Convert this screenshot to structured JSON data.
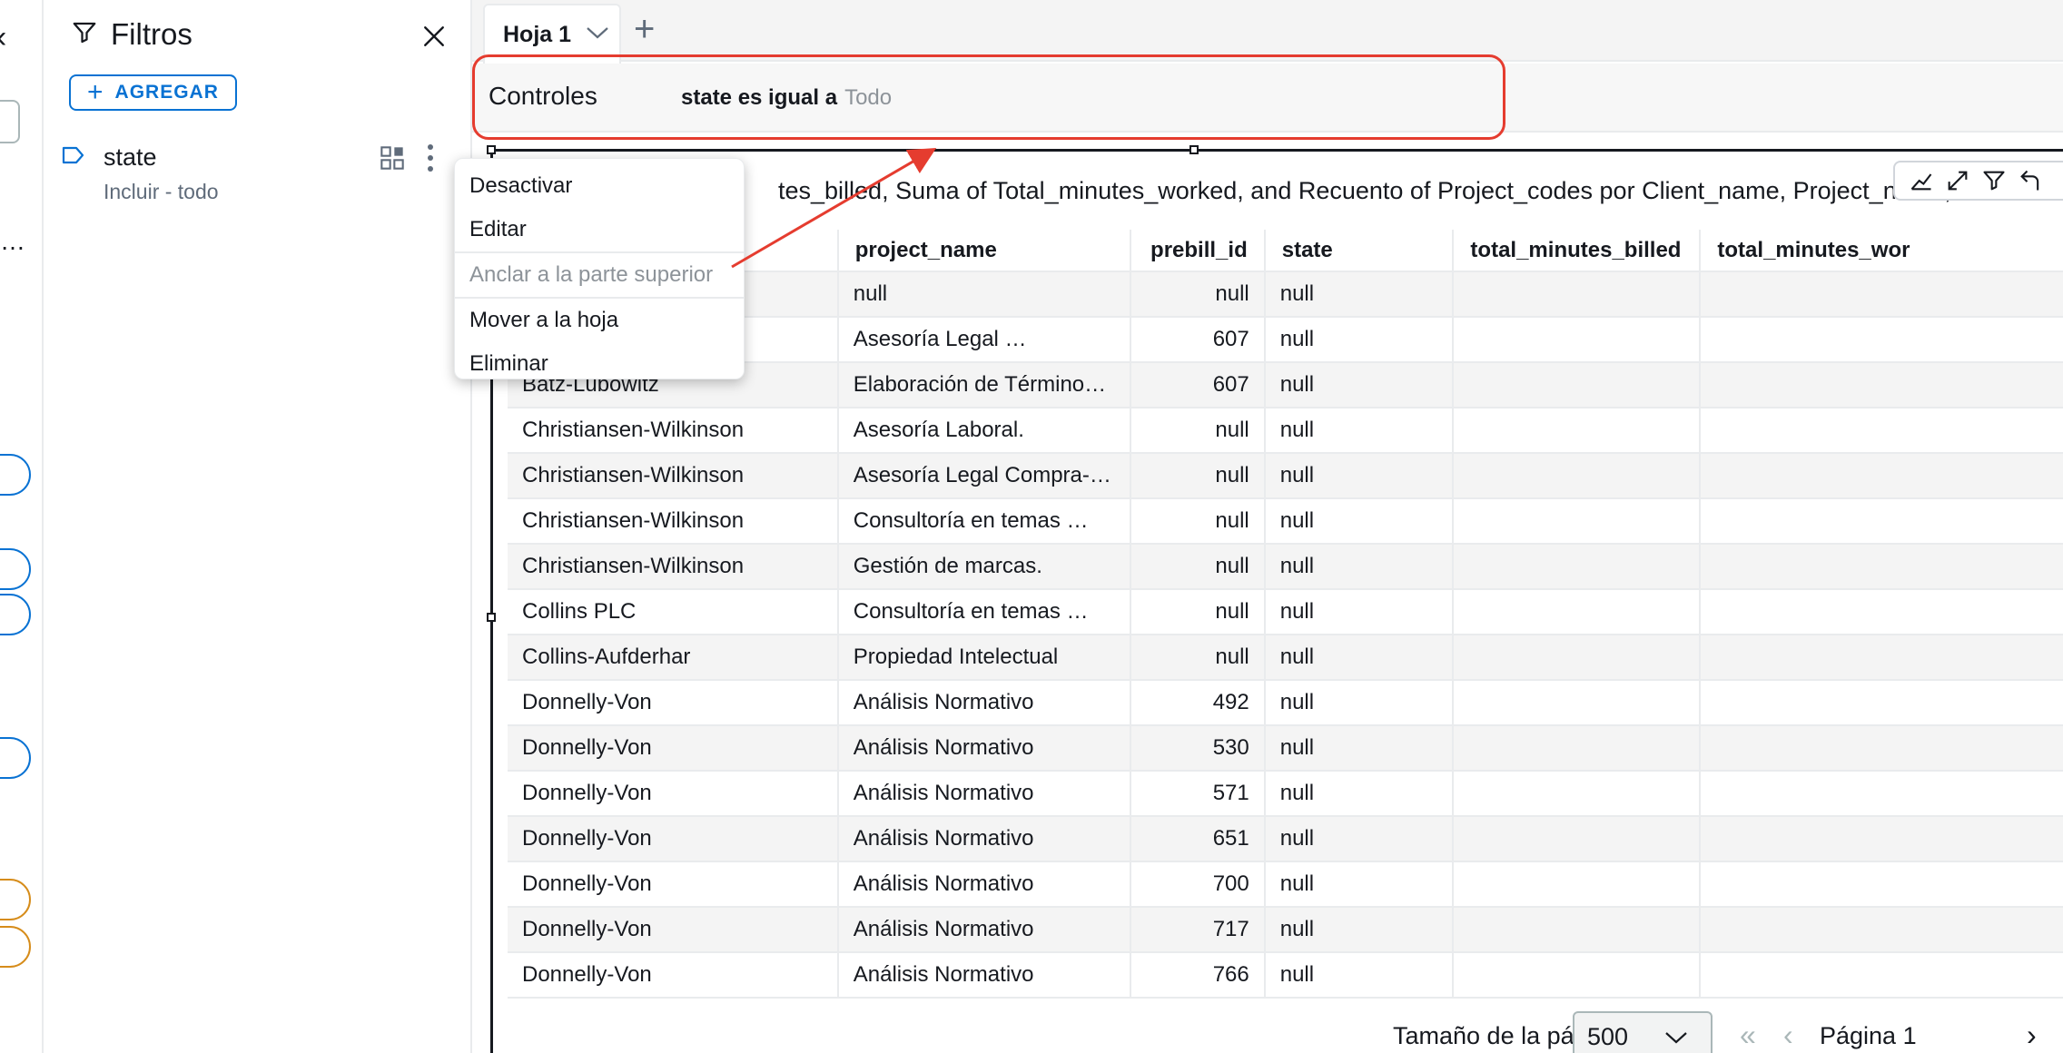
{
  "filters_panel": {
    "title": "Filtros",
    "add_button": "AGREGAR",
    "filter": {
      "name": "state",
      "subtitle": "Incluir - todo"
    }
  },
  "context_menu": {
    "items": [
      "Desactivar",
      "Editar",
      "Anclar a la parte superior",
      "Mover a la hoja",
      "Eliminar"
    ]
  },
  "sheet": {
    "tab_label": "Hoja 1"
  },
  "controls": {
    "label": "Controles",
    "condition": "state es igual a",
    "value": "Todo"
  },
  "visual": {
    "title": "tes_billed, Suma of Total_minutes_worked, and Recuento of Project_codes por Client_name, Project_name, Pr",
    "columns": [
      "project_name",
      "prebill_id",
      "state",
      "total_minutes_billed",
      "total_minutes_wor"
    ],
    "rows": [
      [
        "",
        "null",
        "null",
        "null",
        "",
        ""
      ],
      [
        "",
        "Asesoría Legal …",
        "607",
        "null",
        "",
        ""
      ],
      [
        "Batz-Lubowitz",
        "Elaboración de Término…",
        "607",
        "null",
        "",
        ""
      ],
      [
        "Christiansen-Wilkinson",
        "Asesoría Laboral.",
        "null",
        "null",
        "",
        ""
      ],
      [
        "Christiansen-Wilkinson",
        "Asesoría Legal Compra-…",
        "null",
        "null",
        "",
        ""
      ],
      [
        "Christiansen-Wilkinson",
        "Consultoría en temas …",
        "null",
        "null",
        "",
        ""
      ],
      [
        "Christiansen-Wilkinson",
        "Gestión de marcas.",
        "null",
        "null",
        "",
        ""
      ],
      [
        "Collins PLC",
        "Consultoría en temas …",
        "null",
        "null",
        "",
        ""
      ],
      [
        "Collins-Aufderhar",
        "Propiedad Intelectual",
        "null",
        "null",
        "",
        ""
      ],
      [
        "Donnelly-Von",
        "Análisis Normativo",
        "492",
        "null",
        "",
        ""
      ],
      [
        "Donnelly-Von",
        "Análisis Normativo",
        "530",
        "null",
        "",
        ""
      ],
      [
        "Donnelly-Von",
        "Análisis Normativo",
        "571",
        "null",
        "",
        ""
      ],
      [
        "Donnelly-Von",
        "Análisis Normativo",
        "651",
        "null",
        "",
        ""
      ],
      [
        "Donnelly-Von",
        "Análisis Normativo",
        "700",
        "null",
        "",
        ""
      ],
      [
        "Donnelly-Von",
        "Análisis Normativo",
        "717",
        "null",
        "",
        ""
      ],
      [
        "Donnelly-Von",
        "Análisis Normativo",
        "766",
        "null",
        "",
        ""
      ]
    ]
  },
  "pager": {
    "size_label": "Tamaño de la página",
    "size_value": "500",
    "page_label": "Página 1"
  },
  "colors": {
    "accent": "#0972d3",
    "highlight": "#e53c2f"
  }
}
